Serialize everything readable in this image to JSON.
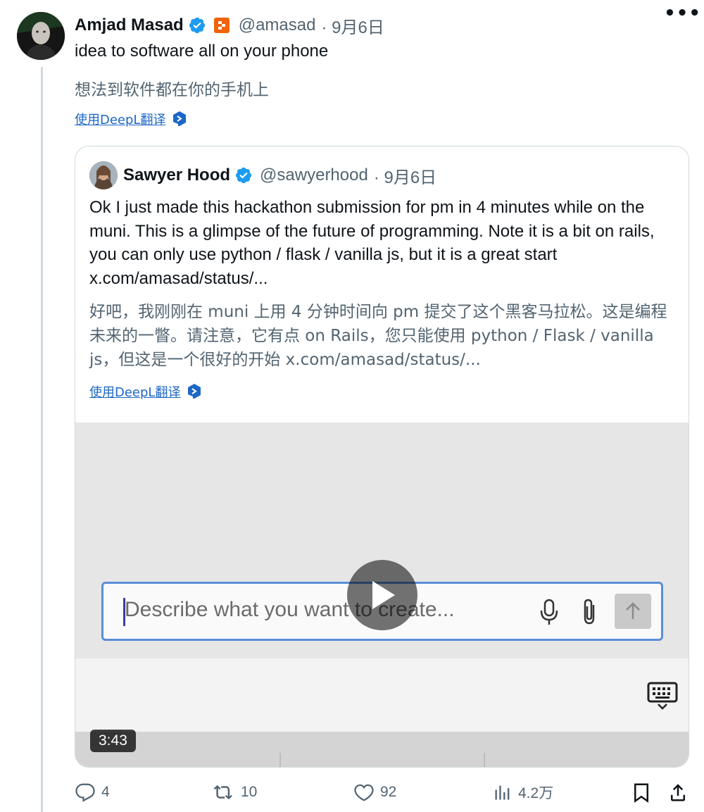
{
  "author": {
    "name": "Amjad Masad",
    "handle": "@amasad",
    "date": "· 9月6日",
    "verified_icon": "verified-badge-icon",
    "affiliate_icon": "replit-badge-icon"
  },
  "tweet": {
    "text": "idea to software all on your phone",
    "translation": "想法到软件都在你的手机上",
    "translate_link": "使用DeepL翻译"
  },
  "quoted": {
    "name": "Sawyer Hood",
    "handle": "@sawyerhood",
    "date": "· 9月6日",
    "text": "Ok I just made this hackathon submission for pm in 4 minutes while on the muni. This is a glimpse of the future of programming. Note it is a bit on rails, you can only use python / flask / vanilla js, but it is a great start x.com/amasad/status/...",
    "translation": "好吧，我刚刚在 muni 上用 4 分钟时间向 pm 提交了这个黑客马拉松。这是编程未来的一瞥。请注意，它有点 on Rails，您只能使用 python / Flask / vanilla js，但这是一个很好的开始 x.com/amasad/status/...",
    "translate_link": "使用DeepL翻译",
    "video": {
      "placeholder": "Describe what you want to create...",
      "duration": "3:43"
    }
  },
  "actions": {
    "replies": "4",
    "reposts": "10",
    "likes": "92",
    "views": "4.2万"
  },
  "colors": {
    "verified": "#1d9bf0",
    "affiliate": "#f26207",
    "link": "#1d67c7",
    "muted": "#536471"
  }
}
